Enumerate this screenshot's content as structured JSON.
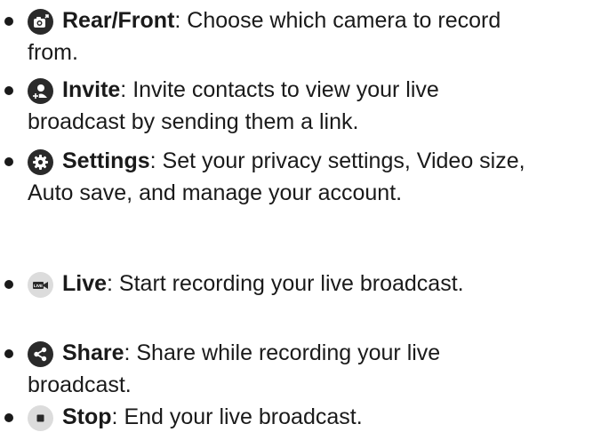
{
  "items": [
    {
      "icon": "camera-switch-icon",
      "term": "Rear/Front",
      "line1_rest": ": Choose which camera to record",
      "line2": "from."
    },
    {
      "icon": "invite-contact-icon",
      "term": "Invite",
      "line1_rest": ": Invite contacts to view your live",
      "line2": "broadcast by sending them a link."
    },
    {
      "icon": "gear-icon",
      "term": "Settings",
      "line1_rest": ": Set your privacy settings, Video size,",
      "line2": "Auto save, and manage your account."
    },
    {
      "icon": "live-icon",
      "icon_text": "LIVE",
      "term": "Live",
      "line1_rest": ": Start recording your live broadcast.",
      "line2": ""
    },
    {
      "icon": "share-icon",
      "term": "Share",
      "line1_rest": ": Share while recording your live",
      "line2": "broadcast."
    },
    {
      "icon": "stop-icon",
      "term": "Stop",
      "line1_rest": ": End your live broadcast.",
      "line2": ""
    }
  ],
  "colors": {
    "text": "#1a1a1a",
    "dark_icon": "#2a2a2a",
    "light_icon": "#dcdcdc"
  }
}
